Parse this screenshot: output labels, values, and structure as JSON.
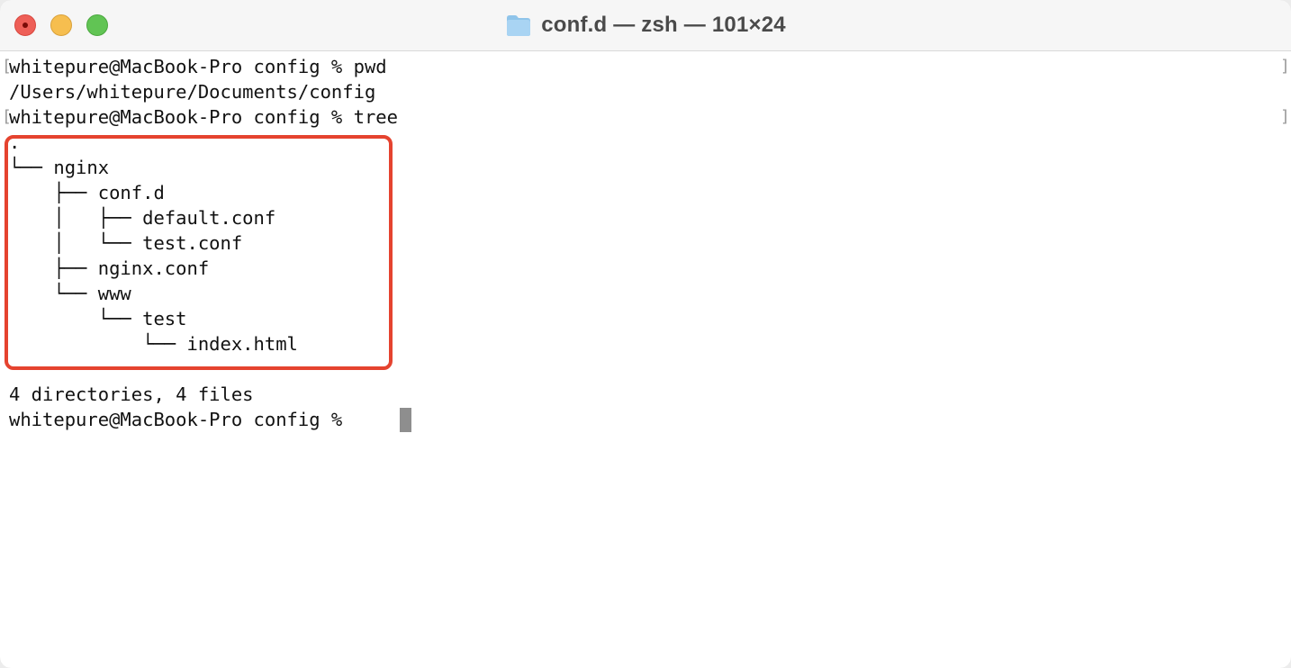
{
  "window": {
    "title": "conf.d — zsh — 101×24",
    "folder_icon": "folder-icon",
    "controls": [
      "close",
      "minimize",
      "zoom"
    ]
  },
  "terminal": {
    "line1": "whitepure@MacBook-Pro config % pwd",
    "line2": "/Users/whitepure/Documents/config",
    "line3": "whitepure@MacBook-Pro config % tree",
    "tree": [
      ".",
      "└── nginx",
      "    ├── conf.d",
      "    │   ├── default.conf",
      "    │   └── test.conf",
      "    ├── nginx.conf",
      "    └── www",
      "        └── test",
      "            └── index.html"
    ],
    "summary": "4 directories, 4 files",
    "prompt": "whitepure@MacBook-Pro config % ",
    "command_mark_left": "[",
    "command_mark_right": "]"
  },
  "colors": {
    "highlight_border": "#e5432f",
    "cursor": "#8e8e8e",
    "close": "#ee5f57",
    "minimize": "#f6be4f",
    "zoom": "#61c454"
  }
}
